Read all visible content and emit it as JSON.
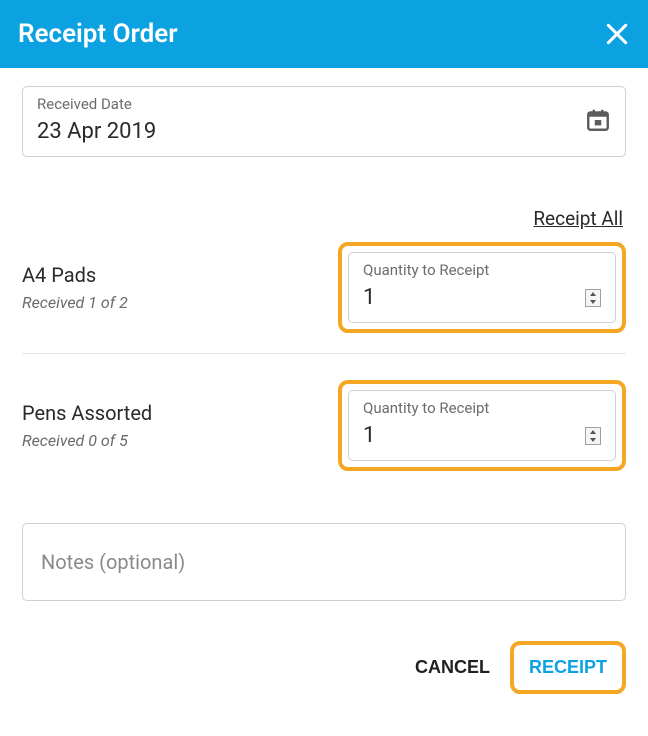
{
  "header": {
    "title": "Receipt Order"
  },
  "receivedDate": {
    "label": "Received Date",
    "value": "23 Apr 2019"
  },
  "receiptAllLabel": "Receipt All",
  "qtyLabel": "Quantity to Receipt",
  "items": [
    {
      "name": "A4 Pads",
      "sub": "Received 1 of 2",
      "qty": "1"
    },
    {
      "name": "Pens Assorted",
      "sub": "Received 0 of 5",
      "qty": "1"
    }
  ],
  "notes": {
    "placeholder": "Notes (optional)"
  },
  "buttons": {
    "cancel": "CANCEL",
    "receipt": "RECEIPT"
  }
}
